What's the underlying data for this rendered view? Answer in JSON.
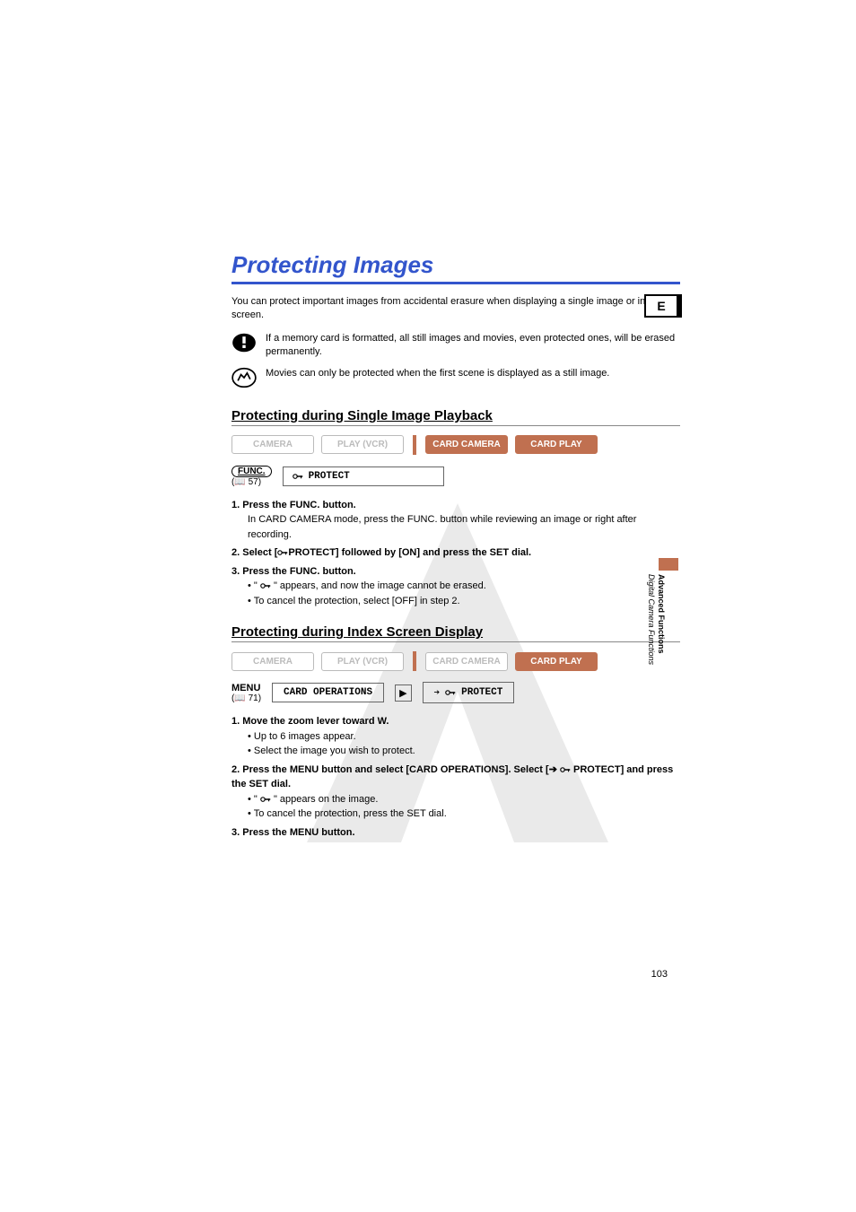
{
  "title": "Protecting Images",
  "intro": "You can protect important images from accidental erasure when displaying a single image or index screen.",
  "notes": {
    "warning": "If a memory card is formatted, all still images and movies, even protected ones, will be erased permanently.",
    "info": "Movies can only be protected when the first scene is displayed as a still image."
  },
  "section1": {
    "heading": "Protecting during Single Image Playback",
    "modes": {
      "m1": "CAMERA",
      "m2": "PLAY (VCR)",
      "m3": "CARD CAMERA",
      "m4": "CARD PLAY"
    },
    "func": {
      "label": "FUNC.",
      "ref": "57",
      "value": "PROTECT"
    },
    "steps": {
      "s1_head": "1.  Press the FUNC. button.",
      "s1_sub": "In CARD CAMERA mode, press the FUNC. button while reviewing an image or right after recording.",
      "s2_head_a": "2.  Select [",
      "s2_head_b": "PROTECT] followed by [ON] and press the SET dial.",
      "s3_head": "3.  Press the FUNC. button.",
      "s3_b1_a": "\" ",
      "s3_b1_b": " \" appears, and now the image cannot be erased.",
      "s3_b2": "To cancel the protection, select [OFF] in step 2."
    }
  },
  "section2": {
    "heading": "Protecting during Index Screen Display",
    "modes": {
      "m1": "CAMERA",
      "m2": "PLAY (VCR)",
      "m3": "CARD CAMERA",
      "m4": "CARD PLAY"
    },
    "menu": {
      "label": "MENU",
      "ref": "71",
      "box1": "CARD OPERATIONS",
      "box2": "PROTECT"
    },
    "steps": {
      "s1_head": "1.  Move the zoom lever toward W.",
      "s1_b1": "Up to 6 images appear.",
      "s1_b2": "Select the image you wish to protect.",
      "s2_head_a": "2.  Press the MENU button and select [CARD OPERATIONS]. Select [",
      "s2_head_b": " PROTECT] and press the SET dial.",
      "s2_b1_a": "\" ",
      "s2_b1_b": " \" appears on the image.",
      "s2_b2": "To cancel the protection, press the SET dial.",
      "s3_head": "3.  Press the MENU button."
    }
  },
  "sidebar": {
    "lang": "E",
    "group_bold": "Advanced Functions",
    "group_italic": "Digital Camera Functions"
  },
  "page_number": "103"
}
